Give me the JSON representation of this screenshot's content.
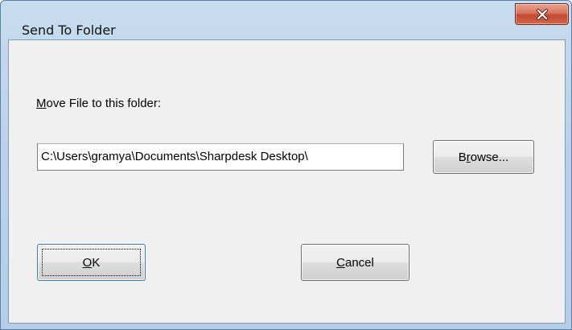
{
  "window": {
    "title": "Send To Folder",
    "close_icon": "close-x-icon"
  },
  "dialog": {
    "prompt_mnemonic": "M",
    "prompt_rest": "ove File to this folder:",
    "path_value": "C:\\Users\\gramya\\Documents\\Sharpdesk Desktop\\",
    "browse": {
      "pre": "B",
      "mnemonic": "r",
      "rest": "owse..."
    },
    "ok": {
      "mnemonic": "O",
      "rest": "K"
    },
    "cancel": {
      "mnemonic": "C",
      "rest": "ancel"
    }
  }
}
